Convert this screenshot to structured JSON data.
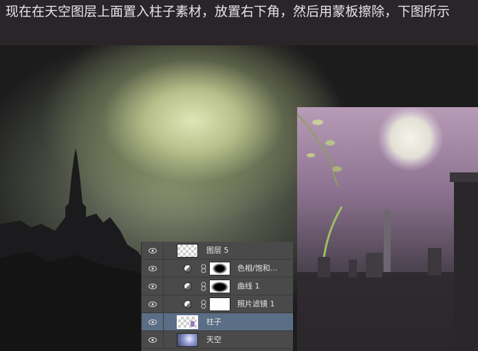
{
  "caption": "现在在天空图层上面置入柱子素材，放置右下角，然后用蒙板擦除，下图所示",
  "layers_panel": {
    "rows": [
      {
        "name": "图层 5",
        "kind": "pixel"
      },
      {
        "name": "色相/饱和...",
        "kind": "adjustment"
      },
      {
        "name": "曲线 1",
        "kind": "adjustment"
      },
      {
        "name": "照片滤镜 1",
        "kind": "adjustment"
      },
      {
        "name": "柱子",
        "kind": "pixel",
        "selected": true
      },
      {
        "name": "天空",
        "kind": "pixel"
      }
    ]
  },
  "colors": {
    "panel_bg": "#4a4a4a",
    "selected_row": "#5a6e86",
    "caption_bg": "#2a2529"
  },
  "icons": [
    "eye-icon",
    "adjustment-layer-icon",
    "chain-link-icon"
  ]
}
